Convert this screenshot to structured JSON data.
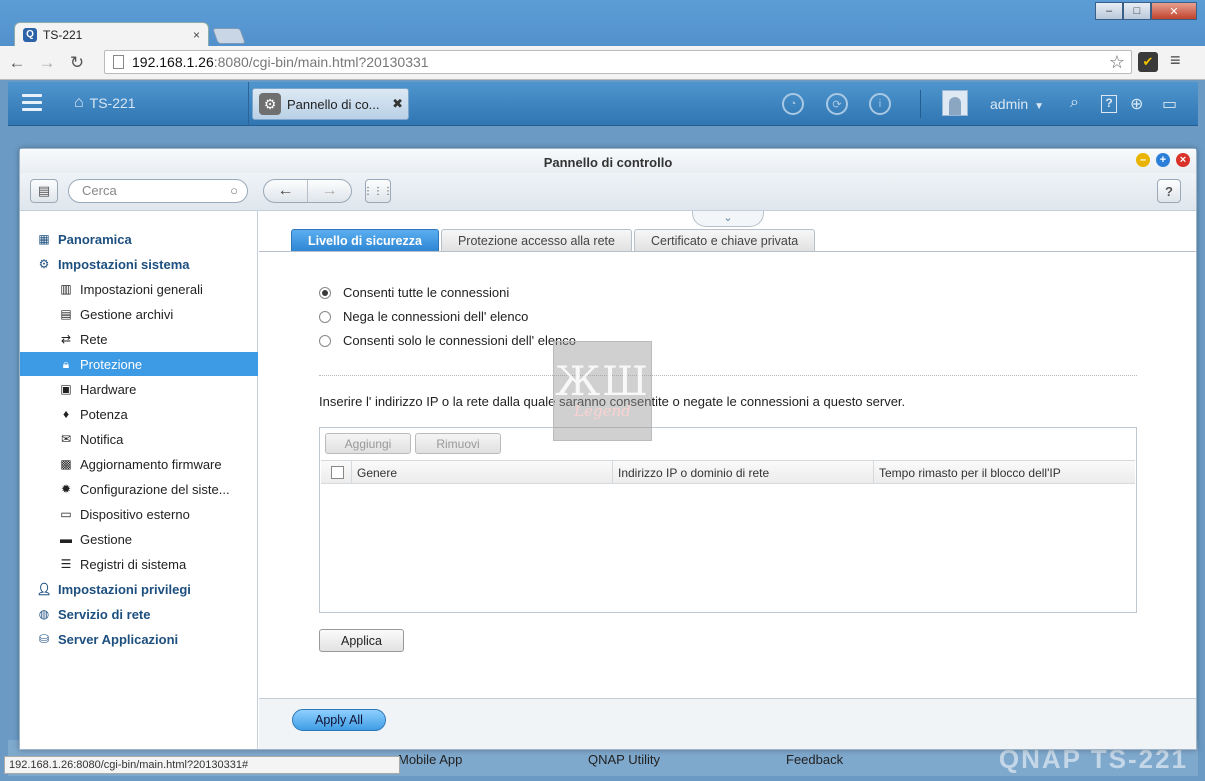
{
  "browser": {
    "tab_title": "TS-221",
    "tab_close": "×",
    "url_host": "192.168.1.26",
    "url_rest": ":8080/cgi-bin/main.html?20130331",
    "status_url": "192.168.1.26:8080/cgi-bin/main.html?20130331#",
    "window_buttons": [
      "–",
      "□",
      "✕"
    ]
  },
  "qnap_bar": {
    "home_label": "TS-221",
    "open_app_tab": "Pannello di co...",
    "user": "admin",
    "help": "?"
  },
  "desktop": {
    "items": [
      "Mobile App",
      "QNAP Utility",
      "Feedback"
    ],
    "logo": "QNAP TS-221"
  },
  "control_panel": {
    "title": "Pannello di controllo",
    "search_placeholder": "Cerca",
    "help": "?",
    "sidebar": [
      {
        "label": "Panoramica",
        "level": "top",
        "icon": "grid-icon"
      },
      {
        "label": "Impostazioni sistema",
        "level": "top",
        "icon": "gear-icon"
      },
      {
        "label": "Impostazioni generali",
        "level": "sub",
        "icon": "settings-doc-icon"
      },
      {
        "label": "Gestione archivi",
        "level": "sub",
        "icon": "storage-icon"
      },
      {
        "label": "Rete",
        "level": "sub",
        "icon": "network-icon"
      },
      {
        "label": "Protezione",
        "level": "sub",
        "icon": "lock-icon",
        "selected": true
      },
      {
        "label": "Hardware",
        "level": "sub",
        "icon": "hardware-icon"
      },
      {
        "label": "Potenza",
        "level": "sub",
        "icon": "bulb-icon"
      },
      {
        "label": "Notifica",
        "level": "sub",
        "icon": "notification-icon"
      },
      {
        "label": "Aggiornamento firmware",
        "level": "sub",
        "icon": "firmware-icon"
      },
      {
        "label": "Configurazione del siste...",
        "level": "sub",
        "icon": "config-icon"
      },
      {
        "label": "Dispositivo esterno",
        "level": "sub",
        "icon": "external-device-icon"
      },
      {
        "label": "Gestione",
        "level": "sub",
        "icon": "monitor-icon"
      },
      {
        "label": "Registri di sistema",
        "level": "sub",
        "icon": "log-icon"
      },
      {
        "label": "Impostazioni privilegi",
        "level": "top",
        "icon": "user-icon"
      },
      {
        "label": "Servizio di rete",
        "level": "top",
        "icon": "globe-icon"
      },
      {
        "label": "Server Applicazioni",
        "level": "top",
        "icon": "server-icon"
      }
    ],
    "tabs": [
      "Livello di sicurezza",
      "Protezione accesso alla rete",
      "Certificato e chiave privata"
    ],
    "radios": [
      {
        "label": "Consenti tutte le connessioni",
        "checked": true
      },
      {
        "label": "Nega le connessioni dell'  elenco",
        "checked": false
      },
      {
        "label": "Consenti solo le connessioni dell'  elenco",
        "checked": false
      }
    ],
    "instruction": "Inserire l'  indirizzo IP o la rete dalla quale saranno consentite o negate le connessioni a questo server.",
    "grid": {
      "add_button": "Aggiungi",
      "remove_button": "Rimuovi",
      "columns": [
        "Genere",
        "Indirizzo IP o dominio di rete",
        "Tempo rimasto per il blocco dell'IP"
      ],
      "rows": []
    },
    "apply_button": "Applica",
    "apply_all_button": "Apply All"
  },
  "colors": {
    "accent": "#3d9ae4",
    "qnap_bar": "#2f76b3",
    "sidebar_top_text": "#1d4f7f"
  }
}
